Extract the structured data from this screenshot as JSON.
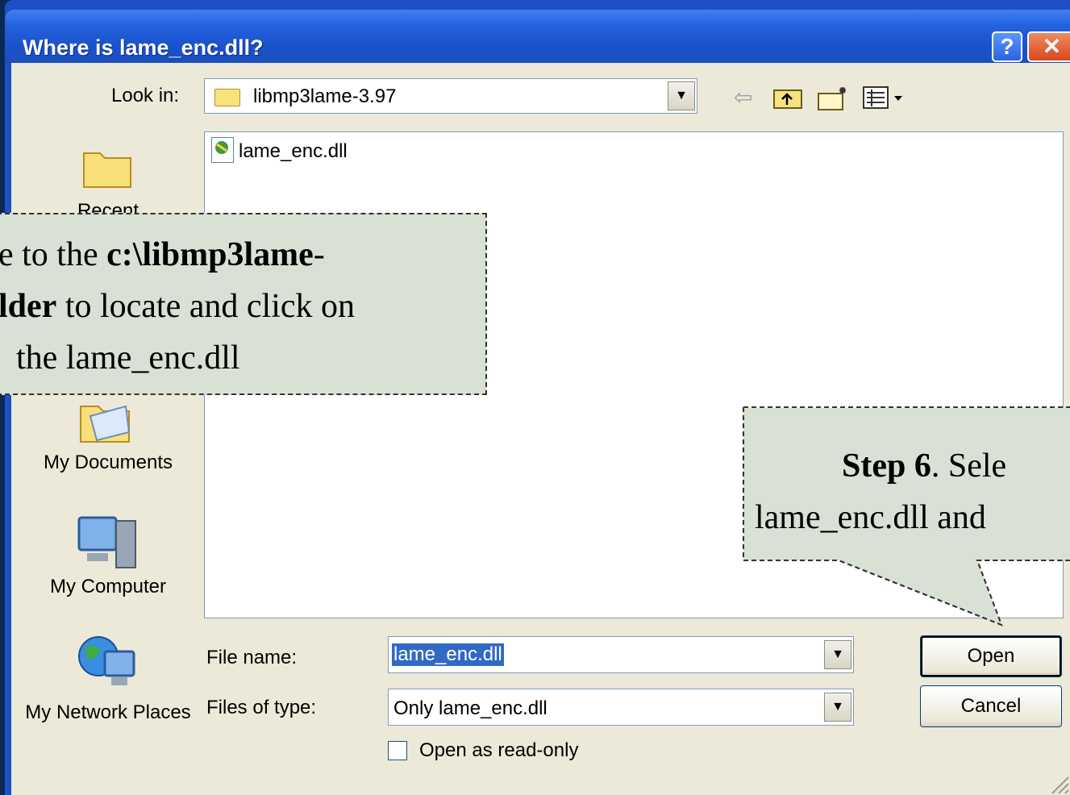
{
  "window": {
    "title": "Where is lame_enc.dll?",
    "help_label": "?",
    "close_label": "✕"
  },
  "lookin": {
    "label": "Look in:",
    "value": "libmp3lame-3.97"
  },
  "toolbar": {
    "icons": [
      "back-arrow-icon",
      "up-folder-icon",
      "new-folder-icon",
      "view-menu-icon"
    ]
  },
  "places": [
    {
      "label": "Recent",
      "icon": "recent-folder-icon"
    },
    {
      "label": "My Documents",
      "icon": "my-documents-icon"
    },
    {
      "label": "My Computer",
      "icon": "my-computer-icon"
    },
    {
      "label": "My Network Places",
      "icon": "network-places-icon"
    }
  ],
  "files": [
    {
      "name": "lame_enc.dll",
      "icon": "dll-file-icon"
    }
  ],
  "filename": {
    "label": "File name:",
    "value": "lame_enc.dll"
  },
  "filetype": {
    "label": "Files of type:",
    "value": "Only lame_enc.dll"
  },
  "readonly": {
    "label": "Open as read-only",
    "checked": false
  },
  "buttons": {
    "open": "Open",
    "cancel": "Cancel"
  },
  "callout_left": {
    "line1_pre": "e to the ",
    "line1_bold": "c:\\libmp3lame",
    "line1_post": "-",
    "line2_bold": "lder",
    "line2_post": " to locate and click on",
    "line3": "the lame_enc.dll"
  },
  "callout_right": {
    "line1_bold": "Step 6",
    "line1_post": ". Sele",
    "line2": "lame_enc.dll and"
  }
}
